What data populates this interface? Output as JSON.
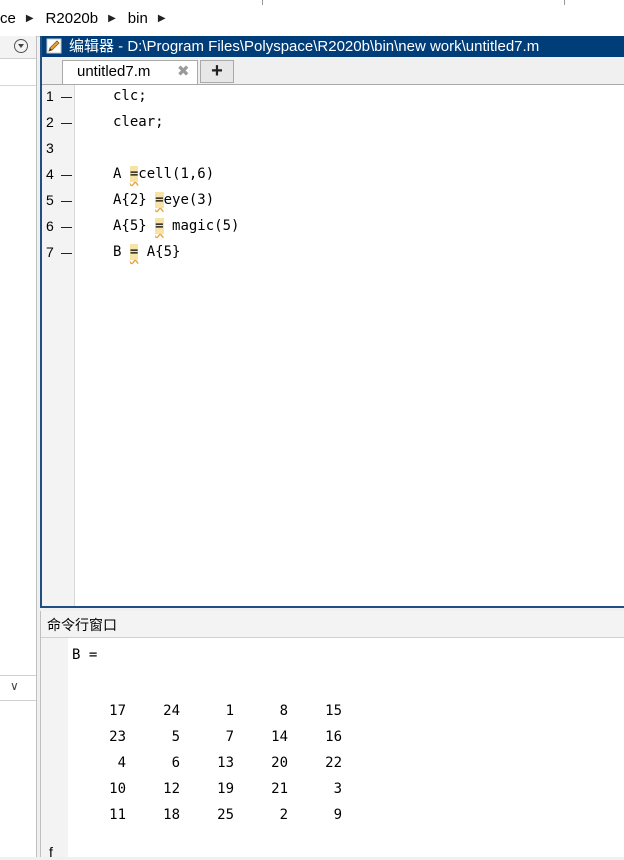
{
  "breadcrumb": {
    "items": [
      "ce",
      "R2020b",
      "bin"
    ]
  },
  "editor": {
    "title": "编辑器 - D:\\Program Files\\Polyspace\\R2020b\\bin\\new work\\untitled7.m",
    "tab_label": "untitled7.m",
    "tab_close": "✖",
    "new_tab": "+",
    "lines": [
      {
        "num": "1",
        "code": "clc;"
      },
      {
        "num": "2",
        "code": "clear;"
      },
      {
        "num": "3",
        "code": ""
      },
      {
        "num": "4",
        "code_parts": [
          "A ",
          "=",
          "cell(1,6)"
        ]
      },
      {
        "num": "5",
        "code_parts": [
          "A{2} ",
          "=",
          "eye(3)"
        ]
      },
      {
        "num": "6",
        "code_parts": [
          "A{5} ",
          "=",
          " magic(5)"
        ]
      },
      {
        "num": "7",
        "code_parts": [
          "B ",
          "=",
          " A{5}"
        ]
      }
    ]
  },
  "command_window": {
    "title": "命令行窗口",
    "variable": "B =",
    "matrix": [
      [
        "17",
        "24",
        "1",
        "8",
        "15"
      ],
      [
        "23",
        "5",
        "7",
        "14",
        "16"
      ],
      [
        "4",
        "6",
        "13",
        "20",
        "22"
      ],
      [
        "10",
        "12",
        "19",
        "21",
        "3"
      ],
      [
        "11",
        "18",
        "25",
        "2",
        "9"
      ]
    ],
    "prompt": "f"
  },
  "colors": {
    "title_bar": "#003d79",
    "warning_highlight": "#f6e3a8"
  }
}
